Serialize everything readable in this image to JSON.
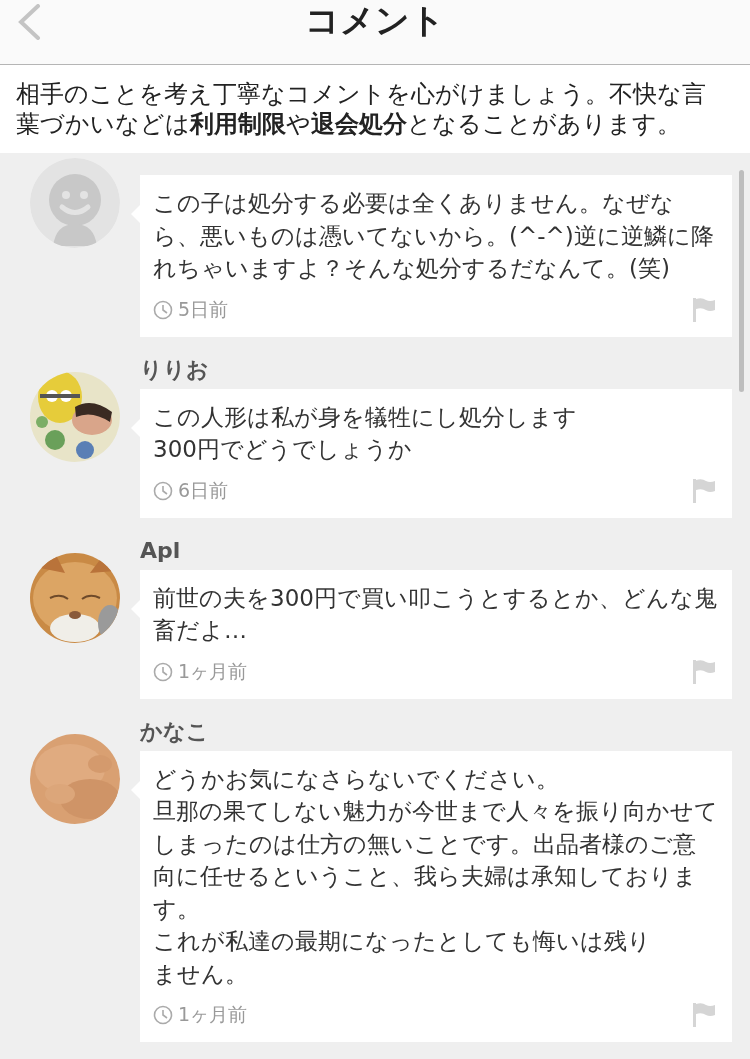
{
  "header": {
    "title": "コメント"
  },
  "notice": "相手のことを考え丁寧なコメントを心がけましょう。不快な言葉づかいなどは**利用制限**や**退会処分**となることがあります。",
  "comments": [
    {
      "avatar": {
        "kind": "default"
      },
      "paragraphs": [
        "この子は処分する必要は全くありません。なぜなら、悪いものは憑いてないから。(^-^)逆に逆鱗に降れちゃいますよ？そんな処分するだなんて。(笑)"
      ],
      "time": "5日前"
    },
    {
      "name": "りりお",
      "avatar": {
        "kind": "picture"
      },
      "paragraphs": [
        "この人形は私が身を犠牲にし処分します",
        "300円でどうでしょうか"
      ],
      "time": "6日前"
    },
    {
      "name": "Apl",
      "avatar": {
        "kind": "picture"
      },
      "paragraphs": [
        "前世の夫を300円で買い叩こうとするとか、どんな鬼畜だよ…"
      ],
      "time": "1ヶ月前"
    },
    {
      "name": "かなこ",
      "avatar": {
        "kind": "picture"
      },
      "paragraphs": [
        "どうかお気になさらないでください。",
        "旦那の果てしない魅力が今世まで人々を振り向かせてしまったのは仕方の無いことです。出品者様のご意向に任せるということ、我ら夫婦は承知しております。",
        "これが私達の最期になったとしても悔いは残り",
        "ません。"
      ],
      "time": "1ヶ月前"
    }
  ]
}
